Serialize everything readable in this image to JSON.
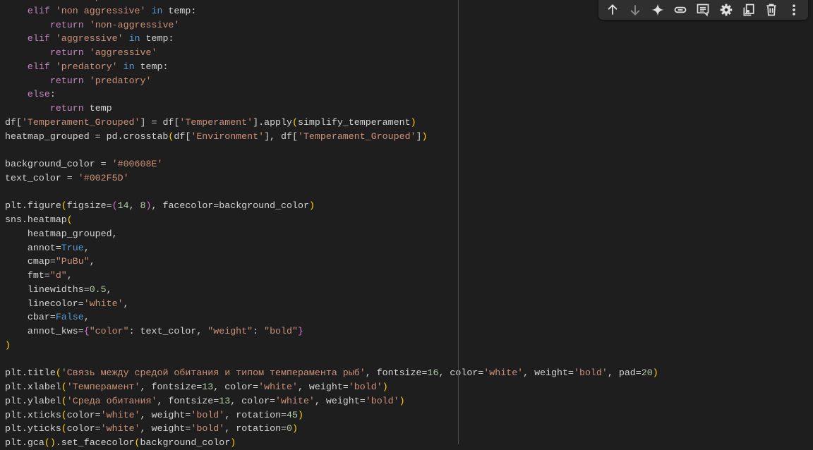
{
  "toolbar": {
    "buttons": [
      {
        "name": "move-cell-up",
        "icon": "arrow-up-icon"
      },
      {
        "name": "move-cell-down",
        "icon": "arrow-down-icon"
      },
      {
        "name": "gemini",
        "icon": "sparkle-icon"
      },
      {
        "name": "copy-link",
        "icon": "link-icon"
      },
      {
        "name": "add-comment",
        "icon": "comment-icon"
      },
      {
        "name": "settings",
        "icon": "gear-icon"
      },
      {
        "name": "mirror-cell",
        "icon": "mirror-tab-icon"
      },
      {
        "name": "delete-cell",
        "icon": "trash-icon"
      },
      {
        "name": "more-actions",
        "icon": "more-vert-icon"
      }
    ]
  },
  "code_lines": [
    [
      [
        "d",
        "        "
      ],
      [
        "k",
        "return"
      ],
      [
        "d",
        " "
      ],
      [
        "s",
        "'peaceful'"
      ]
    ],
    [
      [
        "d",
        "    "
      ],
      [
        "k",
        "elif"
      ],
      [
        "d",
        " "
      ],
      [
        "s",
        "'non aggressive'"
      ],
      [
        "d",
        " "
      ],
      [
        "b",
        "in"
      ],
      [
        "d",
        " temp:"
      ]
    ],
    [
      [
        "d",
        "        "
      ],
      [
        "k",
        "return"
      ],
      [
        "d",
        " "
      ],
      [
        "s",
        "'non-aggressive'"
      ]
    ],
    [
      [
        "d",
        "    "
      ],
      [
        "k",
        "elif"
      ],
      [
        "d",
        " "
      ],
      [
        "s",
        "'aggressive'"
      ],
      [
        "d",
        " "
      ],
      [
        "b",
        "in"
      ],
      [
        "d",
        " temp:"
      ]
    ],
    [
      [
        "d",
        "        "
      ],
      [
        "k",
        "return"
      ],
      [
        "d",
        " "
      ],
      [
        "s",
        "'aggressive'"
      ]
    ],
    [
      [
        "d",
        "    "
      ],
      [
        "k",
        "elif"
      ],
      [
        "d",
        " "
      ],
      [
        "s",
        "'predatory'"
      ],
      [
        "d",
        " "
      ],
      [
        "b",
        "in"
      ],
      [
        "d",
        " temp:"
      ]
    ],
    [
      [
        "d",
        "        "
      ],
      [
        "k",
        "return"
      ],
      [
        "d",
        " "
      ],
      [
        "s",
        "'predatory'"
      ]
    ],
    [
      [
        "d",
        "    "
      ],
      [
        "k",
        "else"
      ],
      [
        "d",
        ":"
      ]
    ],
    [
      [
        "d",
        "        "
      ],
      [
        "k",
        "return"
      ],
      [
        "d",
        " temp"
      ]
    ],
    [
      [
        "d",
        "df["
      ],
      [
        "s",
        "'Temperament_Grouped'"
      ],
      [
        "d",
        "] = df["
      ],
      [
        "s",
        "'Temperament'"
      ],
      [
        "d",
        "].apply"
      ],
      [
        "p1",
        "("
      ],
      [
        "d",
        "simplify_temperament"
      ],
      [
        "p1",
        ")"
      ]
    ],
    [
      [
        "d",
        "heatmap_grouped = pd.crosstab"
      ],
      [
        "p1",
        "("
      ],
      [
        "d",
        "df["
      ],
      [
        "s",
        "'Environment'"
      ],
      [
        "d",
        "], df["
      ],
      [
        "s",
        "'Temperament_Grouped'"
      ],
      [
        "d",
        "]"
      ],
      [
        "p1",
        ")"
      ]
    ],
    [],
    [
      [
        "d",
        "background_color = "
      ],
      [
        "s",
        "'#00608E'"
      ]
    ],
    [
      [
        "d",
        "text_color = "
      ],
      [
        "s",
        "'#002F5D'"
      ]
    ],
    [],
    [
      [
        "d",
        "plt.figure"
      ],
      [
        "p1",
        "("
      ],
      [
        "d",
        "figsize="
      ],
      [
        "p2",
        "("
      ],
      [
        "n",
        "14"
      ],
      [
        "d",
        ", "
      ],
      [
        "n",
        "8"
      ],
      [
        "p2",
        ")"
      ],
      [
        "d",
        ", facecolor=background_color"
      ],
      [
        "p1",
        ")"
      ]
    ],
    [
      [
        "d",
        "sns.heatmap"
      ],
      [
        "p1",
        "("
      ]
    ],
    [
      [
        "d",
        "    heatmap_grouped,"
      ]
    ],
    [
      [
        "d",
        "    annot="
      ],
      [
        "b",
        "True"
      ],
      [
        "d",
        ","
      ]
    ],
    [
      [
        "d",
        "    cmap="
      ],
      [
        "s",
        "\"PuBu\""
      ],
      [
        "d",
        ","
      ]
    ],
    [
      [
        "d",
        "    fmt="
      ],
      [
        "s",
        "\"d\""
      ],
      [
        "d",
        ","
      ]
    ],
    [
      [
        "d",
        "    linewidths="
      ],
      [
        "n",
        "0.5"
      ],
      [
        "d",
        ","
      ]
    ],
    [
      [
        "d",
        "    linecolor="
      ],
      [
        "s",
        "'white'"
      ],
      [
        "d",
        ","
      ]
    ],
    [
      [
        "d",
        "    cbar="
      ],
      [
        "b",
        "False"
      ],
      [
        "d",
        ","
      ]
    ],
    [
      [
        "d",
        "    annot_kws="
      ],
      [
        "p2",
        "{"
      ],
      [
        "s",
        "\"color\""
      ],
      [
        "d",
        ": text_color, "
      ],
      [
        "s",
        "\"weight\""
      ],
      [
        "d",
        ": "
      ],
      [
        "s",
        "\"bold\""
      ],
      [
        "p2",
        "}"
      ]
    ],
    [
      [
        "p1",
        ")"
      ]
    ],
    [],
    [
      [
        "d",
        "plt.title"
      ],
      [
        "p1",
        "("
      ],
      [
        "s",
        "'Связь между средой обитания и типом темперамента рыб'"
      ],
      [
        "d",
        ", fontsize="
      ],
      [
        "n",
        "16"
      ],
      [
        "d",
        ", color="
      ],
      [
        "s",
        "'white'"
      ],
      [
        "d",
        ", weight="
      ],
      [
        "s",
        "'bold'"
      ],
      [
        "d",
        ", pad="
      ],
      [
        "n",
        "20"
      ],
      [
        "p1",
        ")"
      ]
    ],
    [
      [
        "d",
        "plt.xlabel"
      ],
      [
        "p1",
        "("
      ],
      [
        "s",
        "'Темперамент'"
      ],
      [
        "d",
        ", fontsize="
      ],
      [
        "n",
        "13"
      ],
      [
        "d",
        ", color="
      ],
      [
        "s",
        "'white'"
      ],
      [
        "d",
        ", weight="
      ],
      [
        "s",
        "'bold'"
      ],
      [
        "p1",
        ")"
      ]
    ],
    [
      [
        "d",
        "plt.ylabel"
      ],
      [
        "p1",
        "("
      ],
      [
        "s",
        "'Среда обитания'"
      ],
      [
        "d",
        ", fontsize="
      ],
      [
        "n",
        "13"
      ],
      [
        "d",
        ", color="
      ],
      [
        "s",
        "'white'"
      ],
      [
        "d",
        ", weight="
      ],
      [
        "s",
        "'bold'"
      ],
      [
        "p1",
        ")"
      ]
    ],
    [
      [
        "d",
        "plt.xticks"
      ],
      [
        "p1",
        "("
      ],
      [
        "d",
        "color="
      ],
      [
        "s",
        "'white'"
      ],
      [
        "d",
        ", weight="
      ],
      [
        "s",
        "'bold'"
      ],
      [
        "d",
        ", rotation="
      ],
      [
        "n",
        "45"
      ],
      [
        "p1",
        ")"
      ]
    ],
    [
      [
        "d",
        "plt.yticks"
      ],
      [
        "p1",
        "("
      ],
      [
        "d",
        "color="
      ],
      [
        "s",
        "'white'"
      ],
      [
        "d",
        ", weight="
      ],
      [
        "s",
        "'bold'"
      ],
      [
        "d",
        ", rotation="
      ],
      [
        "n",
        "0"
      ],
      [
        "p1",
        ")"
      ]
    ],
    [
      [
        "d",
        "plt.gca"
      ],
      [
        "p1",
        "("
      ],
      [
        "p1",
        ")"
      ],
      [
        "d",
        ".set_facecolor"
      ],
      [
        "p1",
        "("
      ],
      [
        "d",
        "background_color"
      ],
      [
        "p1",
        ")"
      ]
    ]
  ]
}
